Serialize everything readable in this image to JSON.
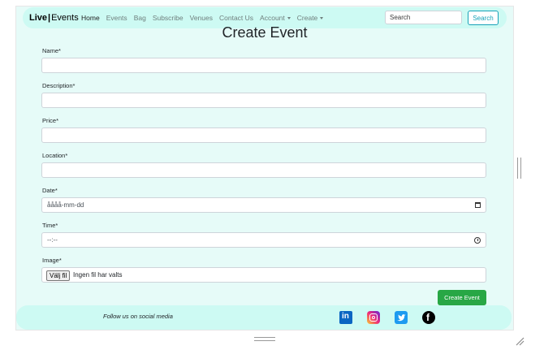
{
  "navbar": {
    "brand_part1": "Live",
    "brand_separator": "|",
    "brand_part2": "Events",
    "links": [
      "Home",
      "Events",
      "Bag",
      "Subscribe",
      "Venues",
      "Contact Us"
    ],
    "dropdowns": [
      "Account",
      "Create"
    ],
    "search_placeholder": "Search",
    "search_button": "Search"
  },
  "page": {
    "title": "Create Event"
  },
  "form": {
    "name_label": "Name*",
    "description_label": "Description*",
    "price_label": "Price*",
    "location_label": "Location*",
    "date_label": "Date*",
    "date_placeholder": "åååå-mm-dd",
    "time_label": "Time*",
    "time_placeholder": "--:--",
    "image_label": "Image*",
    "file_button": "Välj fil",
    "file_status": "Ingen fil har valts",
    "submit": "Create Event"
  },
  "footer": {
    "follow_text": "Follow us on social media",
    "icons": [
      "linkedin-icon",
      "instagram-icon",
      "twitter-icon",
      "facebook-icon"
    ]
  },
  "colors": {
    "page_background": "#e6fbf8",
    "nav_background": "#cdfaf3",
    "search_accent": "#17a2b8",
    "submit_green": "#28a745"
  }
}
